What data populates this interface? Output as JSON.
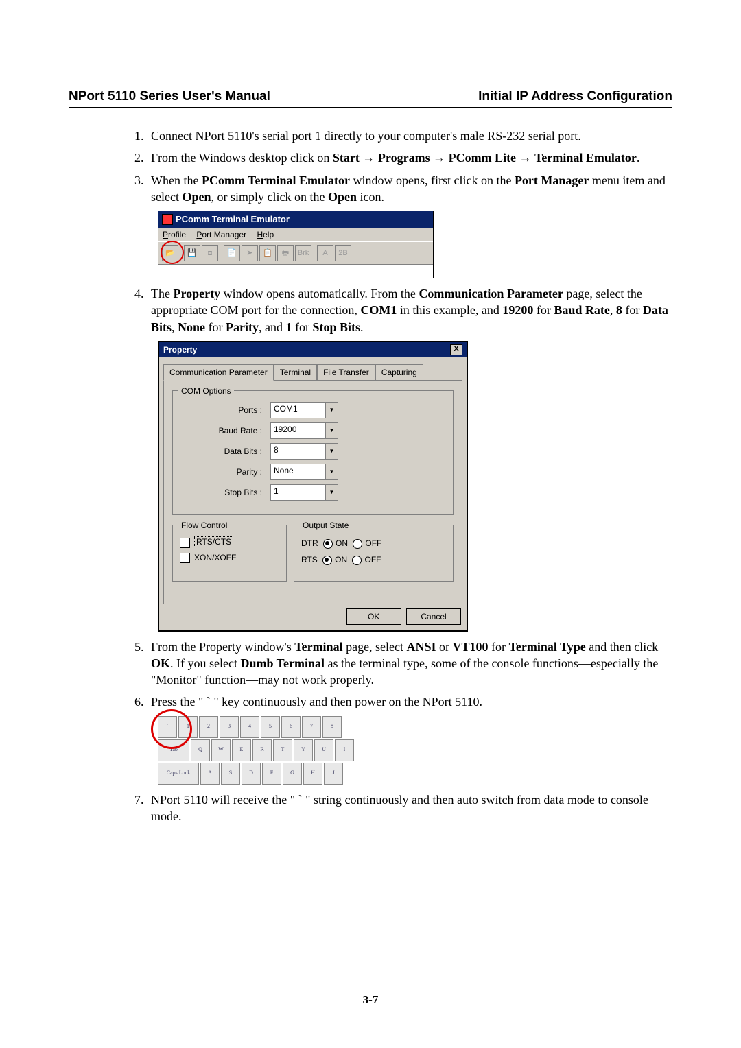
{
  "header": {
    "left": "NPort 5110 Series User's Manual",
    "right": "Initial IP Address Configuration"
  },
  "steps": {
    "s1": "Connect NPort 5110's serial port 1 directly to your computer's male RS-232 serial port.",
    "s2_a": "From the Windows desktop click on ",
    "s2_start": "Start",
    "s2_programs": "Programs",
    "s2_pcomm": "PComm Lite",
    "s2_term": "Terminal Emulator",
    "s2_period": ".",
    "s3_a": "When the ",
    "s3_b": "PComm Terminal Emulator",
    "s3_c": " window opens, first click on the ",
    "s3_d": "Port Manager",
    "s3_e": " menu item and select ",
    "s3_f": "Open",
    "s3_g": ", or simply click on the ",
    "s3_h": "Open",
    "s3_i": " icon.",
    "s4_a": "The ",
    "s4_b": "Property",
    "s4_c": " window opens automatically. From the ",
    "s4_d": "Communication Parameter",
    "s4_e": " page, select the appropriate COM port for the connection, ",
    "s4_f": "COM1",
    "s4_g": " in this example, and ",
    "s4_h": "19200",
    "s4_i": " for ",
    "s4_j": "Baud Rate",
    "s4_k": ", ",
    "s4_l": "8",
    "s4_m": " for ",
    "s4_n": "Data Bits",
    "s4_o": ", ",
    "s4_p": "None",
    "s4_q": " for ",
    "s4_r": "Parity",
    "s4_s": ", and ",
    "s4_t": "1",
    "s4_u": " for ",
    "s4_v": "Stop Bits",
    "s4_w": ".",
    "s5_a": "From the Property window's ",
    "s5_b": "Terminal",
    "s5_c": " page, select ",
    "s5_d": "ANSI",
    "s5_e": " or ",
    "s5_f": "VT100",
    "s5_g": " for ",
    "s5_h": "Terminal Type",
    "s5_i": " and then click ",
    "s5_j": "OK",
    "s5_k": ". If you select ",
    "s5_l": "Dumb Terminal",
    "s5_m": " as the terminal type, some of the console functions—especially the \"Monitor\" function—may not work properly.",
    "s6": "Press the \" ` \" key continuously and then power on the NPort 5110.",
    "s7": "NPort 5110 will receive the \" ` \" string continuously and then auto switch from data mode to console mode."
  },
  "arrow": "→",
  "pcomm": {
    "title": "PComm Terminal Emulator",
    "menu": {
      "profile": "Profile",
      "port": "Port Manager",
      "help": "Help"
    },
    "tb": {
      "brk": "Brk",
      "two_b": "2B"
    }
  },
  "property": {
    "title": "Property",
    "close": "X",
    "tabs": [
      "Communication Parameter",
      "Terminal",
      "File Transfer",
      "Capturing"
    ],
    "com_options": "COM Options",
    "labels": {
      "ports": "Ports :",
      "baud": "Baud Rate :",
      "databits": "Data Bits :",
      "parity": "Parity :",
      "stopbits": "Stop Bits :"
    },
    "values": {
      "ports": "COM1",
      "baud": "19200",
      "databits": "8",
      "parity": "None",
      "stopbits": "1"
    },
    "flow": {
      "title": "Flow Control",
      "rtscts": "RTS/CTS",
      "xonxoff": "XON/XOFF"
    },
    "output": {
      "title": "Output State",
      "dtr": "DTR",
      "rts": "RTS",
      "on": "ON",
      "off": "OFF"
    },
    "ok": "OK",
    "cancel": "Cancel"
  },
  "keyboard_label": "Caps Lock",
  "page_number": "3-7"
}
